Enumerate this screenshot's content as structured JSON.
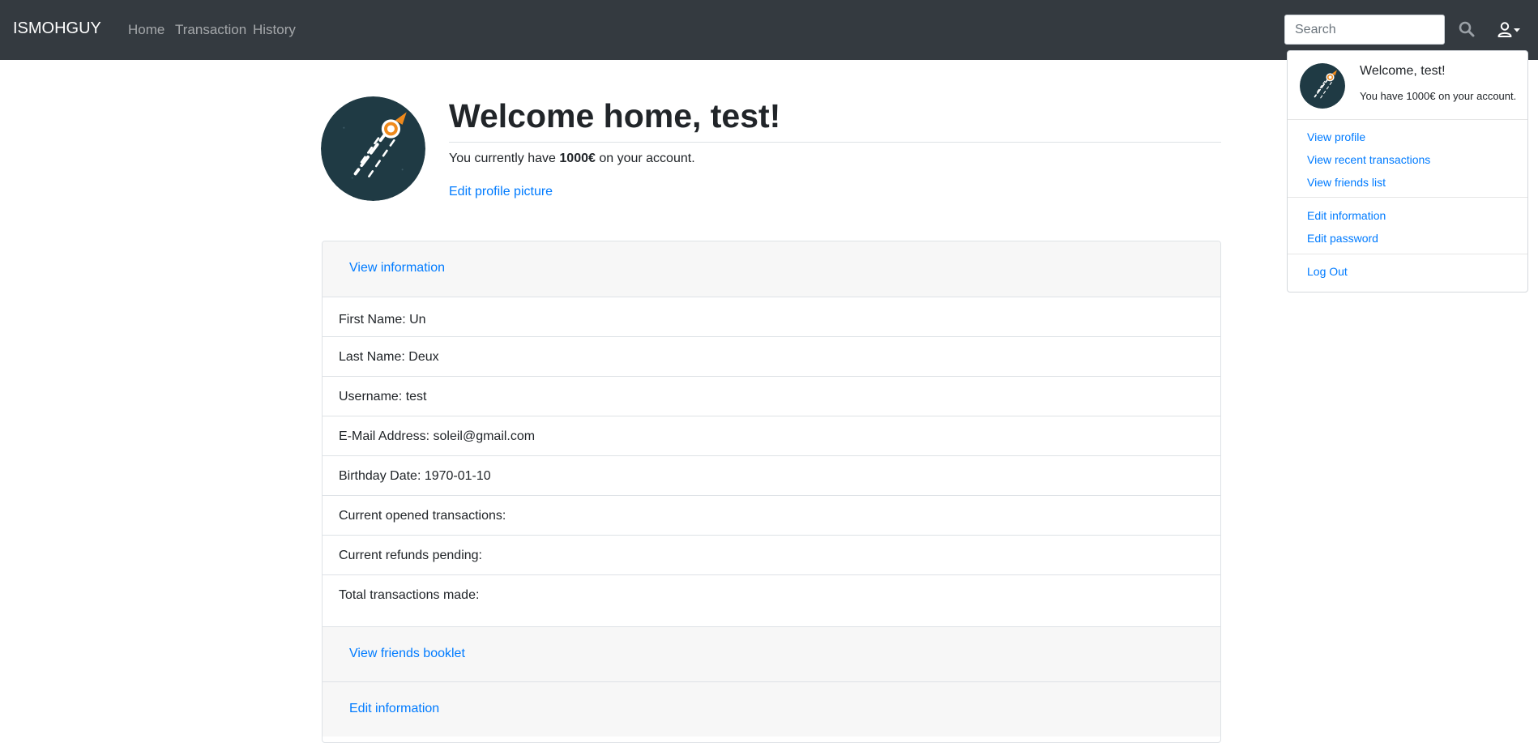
{
  "navbar": {
    "brand": "ISMOHGUY",
    "links": [
      "Home",
      "Transaction",
      "History"
    ],
    "search_placeholder": "Search"
  },
  "profile": {
    "welcome_title": "Welcome home, test!",
    "balance_prefix": "You currently have ",
    "balance_amount": "1000€",
    "balance_suffix": " on your account.",
    "edit_picture_link": "Edit profile picture"
  },
  "card": {
    "view_information": "View information",
    "rows": [
      "First Name: Un",
      "Last Name: Deux",
      "Username: test",
      "E-Mail Address: soleil@gmail.com",
      "Birthday Date: 1970-01-10",
      "Current opened transactions:",
      "Current refunds pending:",
      "Total transactions made:"
    ],
    "view_friends_booklet": "View friends booklet",
    "edit_information": "Edit information"
  },
  "dropdown": {
    "welcome": "Welcome, test!",
    "balance": "You have 1000€ on your account.",
    "items": {
      "view_profile": "View profile",
      "view_recent_transactions": "View recent transactions",
      "view_friends_list": "View friends list",
      "edit_information": "Edit information",
      "edit_password": "Edit password",
      "log_out": "Log Out"
    }
  },
  "colors": {
    "navbar_bg": "#343a40",
    "link": "#007bff",
    "avatar_bg": "#1f3a44",
    "rocket_accent": "#f08a1c"
  },
  "icons": {
    "search": "search-icon",
    "user_menu": "user-icon",
    "caret": "caret-down-icon",
    "avatar": "rocket-avatar-icon"
  }
}
